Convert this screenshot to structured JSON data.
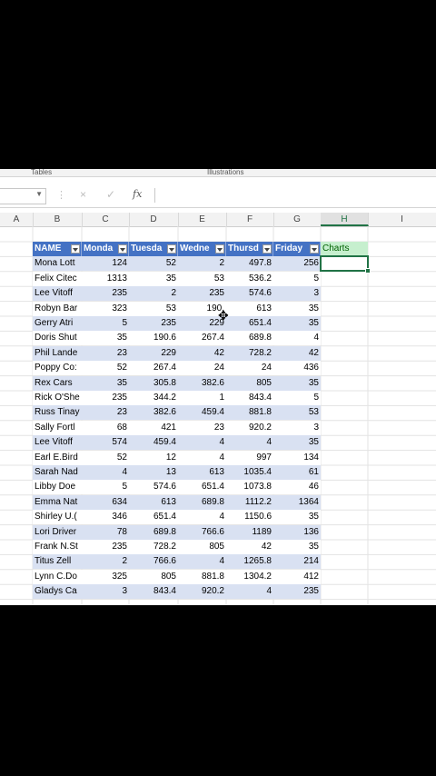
{
  "ribbon": {
    "group_left": "Tables",
    "group_right": "Illustrations"
  },
  "formula_bar": {
    "cancel_icon": "×",
    "confirm_icon": "✓",
    "fx_label": "fx",
    "value": ""
  },
  "columns": [
    "A",
    "B",
    "C",
    "D",
    "E",
    "F",
    "G",
    "H",
    "I"
  ],
  "table": {
    "headers": [
      "NAME",
      "Monda",
      "Tuesda",
      "Wedne",
      "Thursd",
      "Friday"
    ],
    "extra_header": "Charts",
    "rows": [
      [
        "Mona Lott",
        "124",
        "52",
        "2",
        "497.8",
        "256"
      ],
      [
        "Felix Citec",
        "1313",
        "35",
        "53",
        "536.2",
        "5"
      ],
      [
        "Lee Vitoff",
        "235",
        "2",
        "235",
        "574.6",
        "3"
      ],
      [
        "Robyn Bar",
        "323",
        "53",
        "190.",
        "613",
        "35"
      ],
      [
        "Gerry Atri",
        "5",
        "235",
        "229",
        "651.4",
        "35"
      ],
      [
        "Doris Shut",
        "35",
        "190.6",
        "267.4",
        "689.8",
        "4"
      ],
      [
        "Phil Lande",
        "23",
        "229",
        "42",
        "728.2",
        "42"
      ],
      [
        "Poppy Co:",
        "52",
        "267.4",
        "24",
        "24",
        "436"
      ],
      [
        "Rex Cars",
        "35",
        "305.8",
        "382.6",
        "805",
        "35"
      ],
      [
        "Rick O'She",
        "235",
        "344.2",
        "1",
        "843.4",
        "5"
      ],
      [
        "Russ Tinay",
        "23",
        "382.6",
        "459.4",
        "881.8",
        "53"
      ],
      [
        "Sally Fortl",
        "68",
        "421",
        "23",
        "920.2",
        "3"
      ],
      [
        "Lee Vitoff",
        "574",
        "459.4",
        "4",
        "4",
        "35"
      ],
      [
        "Earl E.Bird",
        "52",
        "12",
        "4",
        "997",
        "134"
      ],
      [
        "Sarah Nad",
        "4",
        "13",
        "613",
        "1035.4",
        "61"
      ],
      [
        "Libby Doe",
        "5",
        "574.6",
        "651.4",
        "1073.8",
        "46"
      ],
      [
        "Emma Nat",
        "634",
        "613",
        "689.8",
        "1112.2",
        "1364"
      ],
      [
        "Shirley U.(",
        "346",
        "651.4",
        "4",
        "1150.6",
        "35"
      ],
      [
        "Lori Driver",
        "78",
        "689.8",
        "766.6",
        "1189",
        "136"
      ],
      [
        "Frank N.St",
        "235",
        "728.2",
        "805",
        "42",
        "35"
      ],
      [
        "Titus Zell",
        "2",
        "766.6",
        "4",
        "1265.8",
        "214"
      ],
      [
        "Lynn C.Do",
        "325",
        "805",
        "881.8",
        "1304.2",
        "412"
      ],
      [
        "Gladys Ca",
        "3",
        "843.4",
        "920.2",
        "4",
        "235"
      ]
    ]
  }
}
